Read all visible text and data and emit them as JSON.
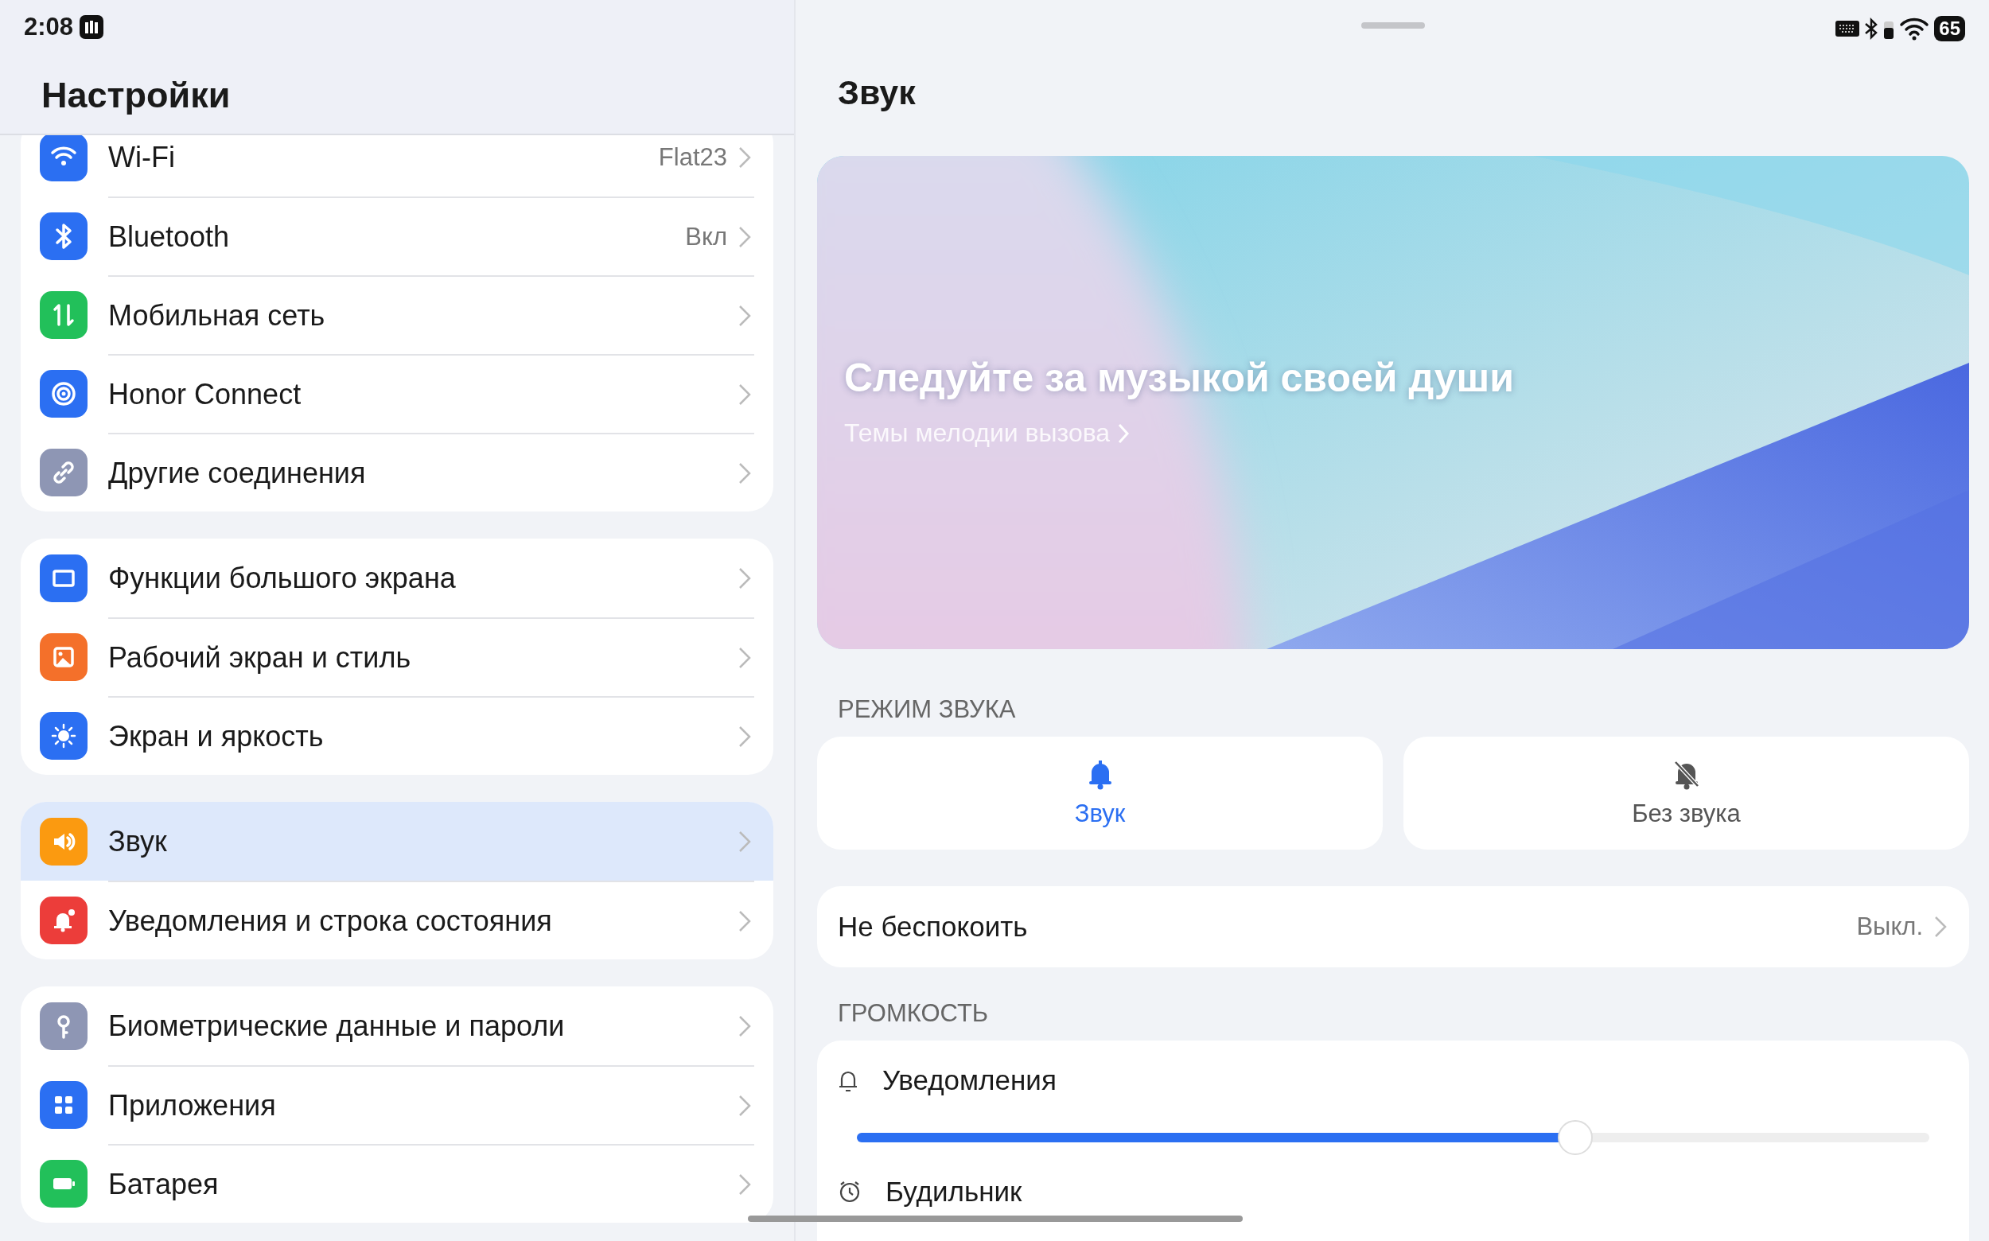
{
  "status_bar": {
    "time": "2:08",
    "battery": "65"
  },
  "sidebar": {
    "title": "Настройки",
    "groups": [
      {
        "items": [
          {
            "label": "Wi-Fi",
            "value": "Flat23",
            "color": "#2b6ff2",
            "selected": false
          },
          {
            "label": "Bluetooth",
            "value": "Вкл",
            "color": "#2b6ff2",
            "selected": false
          },
          {
            "label": "Мобильная сеть",
            "color": "#22c05a",
            "selected": false
          },
          {
            "label": "Honor Connect",
            "color": "#2b6ff2",
            "selected": false
          },
          {
            "label": "Другие соединения",
            "color": "#8e96b4",
            "selected": false
          }
        ]
      },
      {
        "items": [
          {
            "label": "Функции большого экрана",
            "color": "#2b6ff2",
            "selected": false
          },
          {
            "label": "Рабочий экран и стиль",
            "color": "#f4702a",
            "selected": false
          },
          {
            "label": "Экран и яркость",
            "color": "#2b6ff2",
            "selected": false
          }
        ]
      },
      {
        "items": [
          {
            "label": "Звук",
            "color": "#fb9a10",
            "selected": true
          },
          {
            "label": "Уведомления и строка состояния",
            "color": "#ec3d3a",
            "selected": false
          }
        ]
      },
      {
        "items": [
          {
            "label": "Биометрические данные и пароли",
            "color": "#8e96b4",
            "selected": false
          },
          {
            "label": "Приложения",
            "color": "#2b6ff2",
            "selected": false
          },
          {
            "label": "Батарея",
            "color": "#22c05a",
            "selected": false
          }
        ]
      }
    ]
  },
  "detail": {
    "title": "Звук",
    "banner": {
      "kind": "picture",
      "headline": "Следуйте за музыкой своей души",
      "link": "Темы мелодии вызова"
    },
    "sound_mode": {
      "label": "РЕЖИМ ЗВУКА",
      "options": [
        {
          "label": "Звук",
          "selected": true
        },
        {
          "label": "Без звука",
          "selected": false
        }
      ]
    },
    "do_not_disturb": {
      "label": "Не беспокоить",
      "value": "Выкл."
    },
    "volume": {
      "label": "ГРОМКОСТЬ",
      "sliders": [
        {
          "label": "Уведомления",
          "level": 0.67
        },
        {
          "label": "Будильник"
        }
      ]
    }
  }
}
